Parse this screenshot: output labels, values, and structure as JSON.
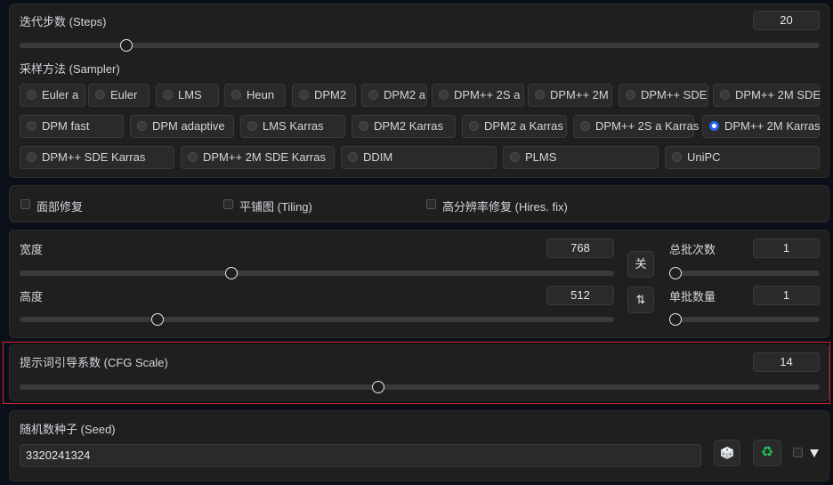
{
  "steps": {
    "label": "迭代步数 (Steps)",
    "value": "20",
    "fraction": 0.133
  },
  "sampler": {
    "label": "采样方法 (Sampler)",
    "rows": [
      [
        "Euler a",
        "Euler",
        "LMS",
        "Heun",
        "DPM2",
        "DPM2 a",
        "DPM++ 2S a",
        "DPM++ 2M",
        "DPM++ SDE",
        "DPM++ 2M SDE"
      ],
      [
        "DPM fast",
        "DPM adaptive",
        "LMS Karras",
        "DPM2 Karras",
        "DPM2 a Karras",
        "DPM++ 2S a Karras",
        "DPM++ 2M Karras"
      ],
      [
        "DPM++ SDE Karras",
        "DPM++ 2M SDE Karras",
        "DDIM",
        "PLMS",
        "UniPC"
      ]
    ],
    "selected": "DPM++ 2M Karras"
  },
  "options": {
    "face_restore": "面部修复",
    "tiling": "平铺图 (Tiling)",
    "hires_fix": "高分辨率修复 (Hires. fix)"
  },
  "dimensions": {
    "width_label": "宽度",
    "width_value": "768",
    "width_fraction": 0.357,
    "height_label": "高度",
    "height_value": "512",
    "height_fraction": 0.232,
    "swap_button": "⇅",
    "lock_button": "关"
  },
  "batch": {
    "count_label": "总批次数",
    "count_value": "1",
    "count_fraction": 0.0,
    "size_label": "单批数量",
    "size_value": "1",
    "size_fraction": 0.0
  },
  "cfg": {
    "label": "提示词引导系数 (CFG Scale)",
    "value": "14",
    "fraction": 0.448
  },
  "seed": {
    "label": "随机数种子 (Seed)",
    "value": "3320241324",
    "dice_icon": "dice-icon",
    "recycle_icon": "recycle-icon",
    "extra_icon": "triangle-down-icon"
  },
  "colors": {
    "accent": "#2563eb",
    "highlight": "#dc2626",
    "recycle": "#22c55e"
  }
}
